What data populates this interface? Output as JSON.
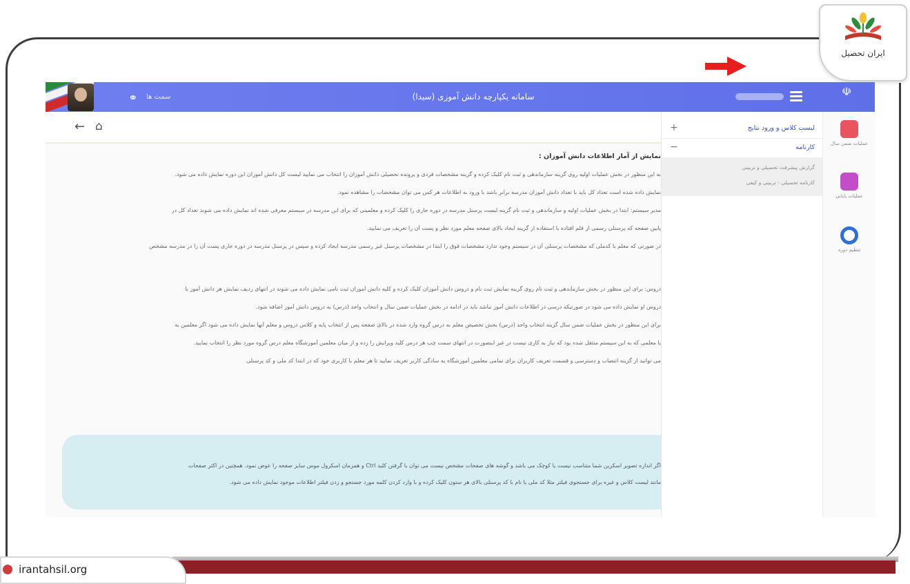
{
  "logo": {
    "text": "ایران تحصیل"
  },
  "watermark": {
    "site": "irantahsil.org"
  },
  "topbar": {
    "mode_label": "سمت ها",
    "title": "سامانه یکپارچه دانش آموزی (سیدا)"
  },
  "menu": {
    "items": [
      {
        "label": "لیست کلاس و ورود نتایج",
        "toggle": "+"
      },
      {
        "label": "کارنامه",
        "toggle": "−"
      }
    ],
    "subitems": [
      "گزارش پیشرفت تحصیلی و تربیتی",
      "کارنامه تحصیلی - تربیتی و کیفی"
    ]
  },
  "rail": {
    "items": [
      {
        "caption": "عملیات ضمن سال",
        "color": "#e8555f"
      },
      {
        "caption": "عملیات پایانی",
        "color": "#c24fc8"
      },
      {
        "caption": "تنظیم دوره",
        "color": "#2f6fd8"
      }
    ]
  },
  "content": {
    "heading": "نمایش از آمار اطلاعات دانش آموزان :",
    "lines": [
      "به این منظور در بخش عملیات اولیه روی گزینه سازماندهی و ثبت نام کلیک کرده و گزینه مشخصات فردی و پرونده تحصیلی دانش آموزان را انتخاب می نمایید لیست کل دانش آموزان این دوره نمایش داده می شود.",
      "نمایش داده شده است تعداد کل باید با تعداد دانش آموزان مدرسه برابر باشد با ورود به اطلاعات هر کس می توان مشخصات را مشاهده نمود.",
      "مدیر سیستم: ابتدا در بخش عملیات اولیه و سازماندهی و ثبت نام گزینه لیست پرسنل مدرسه در دوره جاری را کلیک کرده و معلمینی که برای این مدرسه در سیستم معرفی شده اند نمایش داده می شوند تعداد کل در",
      "پایین صفحه که پرسنلی رسمی از قلم افتاده با استفاده از گزینه ایجاد بالای صفحه معلم مورد نظر و پست آن را تعریف می نمایید.",
      "در صورتی که معلم با کدملی که مشخصات پرسنلی آن در سیستم وجود ندارد مشخصات فوق را ابتدا در مشخصات پرسنل غیر رسمی مدرسه ایجاد کرده و سپس در پرسنل مدرسه در دوره جاری پست آن را در مدرسه مشخص",
      "",
      "دروس: برای این منظور در بخش سازماندهی و ثبت نام روی گزینه نمایش ثبت نام و دروس دانش آموزان کلیک کرده و کلیه دانش آموزان ثبت نامی نمایش داده می شوند در انتهای ردیف نمایش هر دانش آموز با",
      "دروس او نمایش داده می شود در صورتیکه درسی در اطلاعات دانش آموز نباشد باید در ادامه در بخش عملیات ضمن سال و انتخاب واحد (درس) به دروس دانش آموز اضافه شود.",
      "برای این منظور در بخش عملیات ضمن سال گزینه انتخاب واحد (درس) بخش تخصیص معلم به درس گروه وارد شده در بالای صفحه پس از انتخاب پایه و کلاس دروس و معلم آنها نمایش داده می شود اگر معلمین به",
      "یا معلمی که به این سیستم منتقل شده بود که نیاز به کاری نیست در غیر اینصورت در انتهای سمت چپ هر درس کلید ویرایش را زده و از میان معلمین آموزشگاه معلم درس گروه مورد نظر را انتخاب نمایید.",
      "می توانید از گزینه انتصاب و دسترسی و قسمت تعریف کاربران برای تمامی معلمین آموزشگاه به سادگی کاربر تعریف نمایید تا هر معلم با کاربری خود که در ابتدا کد ملی و کد پرسنلی"
    ]
  },
  "notice": {
    "lines": [
      "اگر اندازه تصویر اسکرین شما متناسب نیست یا کوچک می باشد و گوشه های صفحات مشخص نیست می توان با گرفتن کلید Ctrl و همزمان اسکرول موس سایز صفحه را عوض نمود. همچنین در اکثر صفحات",
      "مانند لیست کلاس و غیره برای جستجوی فیلتر مثلا کد ملی یا نام با کد پرسنلی بالای هر ستون کلیک کرده و با وارد کردن کلمه مورد جستجو و زدن فیلتر اطلاعات موجود نمایش داده می شود."
    ]
  }
}
